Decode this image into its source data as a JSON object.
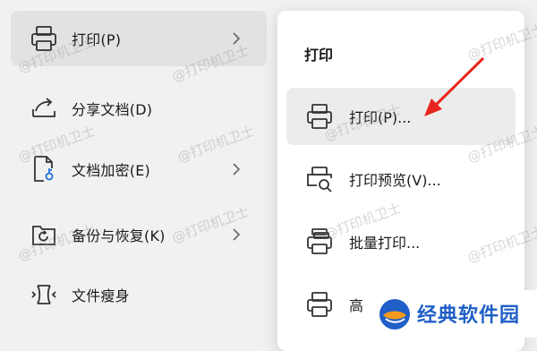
{
  "main_menu": {
    "items": [
      {
        "label": "打印(P)",
        "icon": "printer-icon",
        "has_submenu": true,
        "active": true
      },
      {
        "label": "分享文档(D)",
        "icon": "share-icon",
        "has_submenu": false,
        "active": false
      },
      {
        "label": "文档加密(E)",
        "icon": "lock-document-icon",
        "has_submenu": true,
        "active": false
      },
      {
        "label": "备份与恢复(K)",
        "icon": "backup-restore-icon",
        "has_submenu": true,
        "active": false
      },
      {
        "label": "文件瘦身",
        "icon": "compress-file-icon",
        "has_submenu": false,
        "active": false
      }
    ]
  },
  "submenu": {
    "title": "打印",
    "items": [
      {
        "label": "打印(P)...",
        "icon": "printer-icon",
        "hovered": true
      },
      {
        "label": "打印预览(V)...",
        "icon": "print-preview-icon",
        "hovered": false
      },
      {
        "label": "批量打印...",
        "icon": "batch-print-icon",
        "hovered": false
      },
      {
        "label": "高",
        "icon": "printer-settings-icon",
        "hovered": false
      }
    ]
  },
  "watermark": {
    "text": "@打印机卫士"
  },
  "brand": {
    "text": "经典软件园"
  },
  "colors": {
    "arrow": "#e8251e",
    "brand": "#1f5fc7",
    "active_bg": "#e2e2e2",
    "hover_bg": "#ececec"
  }
}
